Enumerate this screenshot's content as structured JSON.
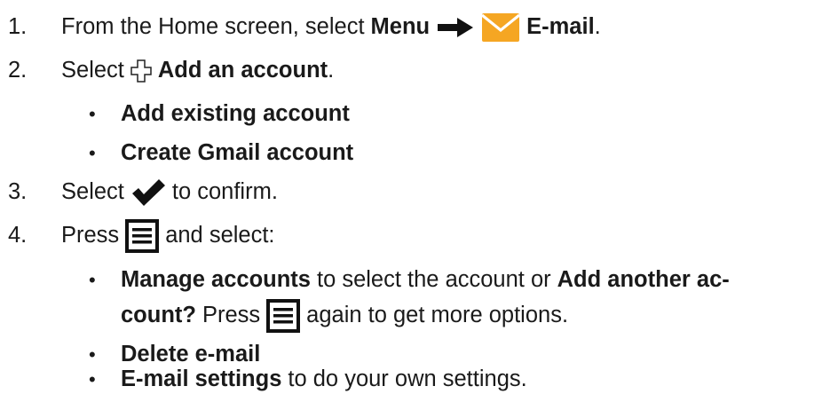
{
  "steps": [
    {
      "num": "1.",
      "pre": "From the Home screen, select",
      "menu": "Menu",
      "email": "E-mail",
      "end": "."
    },
    {
      "num": "2.",
      "pre": "Select",
      "add": "Add an account",
      "end": ".",
      "bullets": [
        "Add existing account",
        "Create Gmail account"
      ]
    },
    {
      "num": "3.",
      "pre": "Select",
      "post": "to confirm."
    },
    {
      "num": "4.",
      "pre": "Press",
      "post": "and select:",
      "bullets": {
        "b1_bold": "Manage accounts",
        "b1_mid": "to select the account or",
        "b1_bold2": "Add another ac-",
        "b1_bold3": "count?",
        "b1_pre": "Press",
        "b1_post": "again to get more options.",
        "b2_bold": "Delete e-mail",
        "b3_bold": "E-mail settings",
        "b3_post": "to do your own settings."
      }
    }
  ],
  "bullet_char": "•",
  "icons": {
    "arrow": "right-arrow-icon",
    "email": "envelope-icon",
    "add": "plus-outline-icon",
    "check": "checkmark-icon",
    "menu": "menu-lines-icon"
  },
  "colors": {
    "envelope": "#f5a623",
    "text": "#1a1a1a"
  }
}
